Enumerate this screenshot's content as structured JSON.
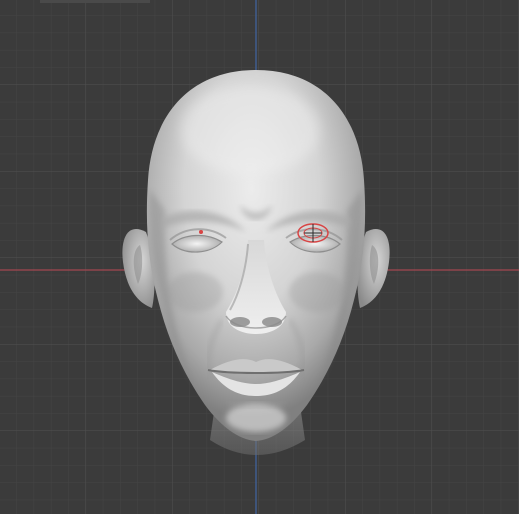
{
  "viewport": {
    "mode": "3d-sculpt-viewport",
    "view": "front-orthographic",
    "colors": {
      "background": "#3b3b3b",
      "grid_minor": "#474747",
      "grid_major": "#525252",
      "axis_x": "#a34751",
      "axis_z": "#3f5f94",
      "mesh_light": "#e6e6e6",
      "mesh_mid": "#b9b9b9",
      "mesh_dark": "#777777",
      "brush_cursor": "#d84444"
    }
  },
  "scene": {
    "object": "head-sculpt",
    "material": "matcap-clay-grey",
    "brush_cursor_visible": true,
    "origin_marker_visible": true
  }
}
